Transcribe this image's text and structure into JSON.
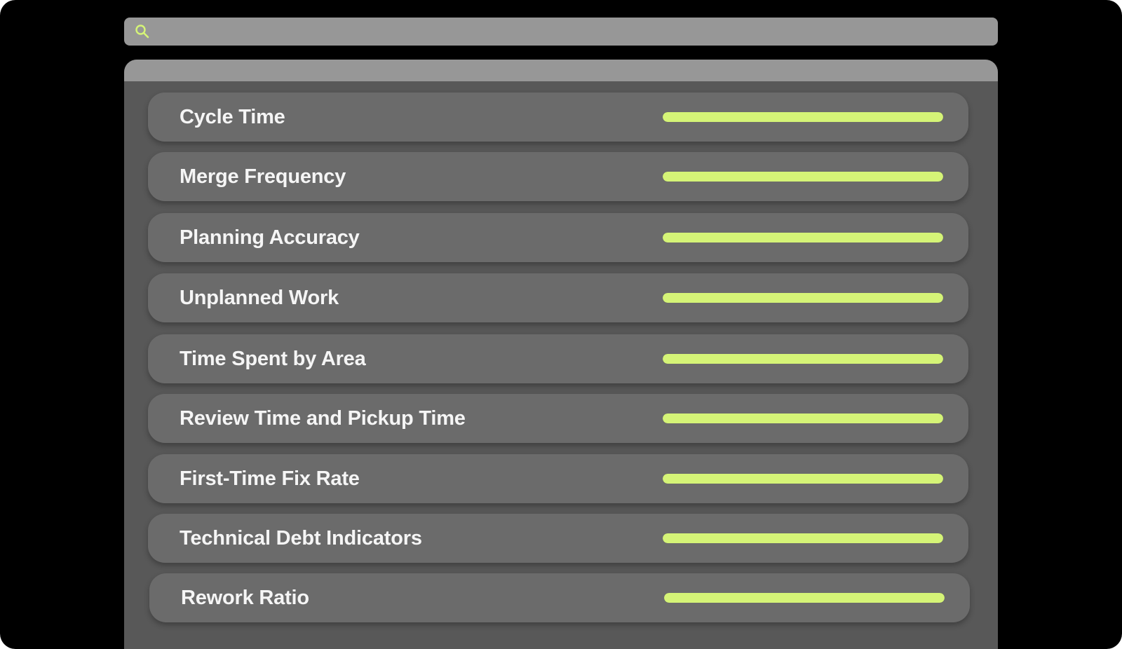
{
  "search": {
    "icon": "search-icon",
    "placeholder": ""
  },
  "colors": {
    "accent": "#d5f477",
    "row_background": "#6b6b6b",
    "panel_background": "#585858",
    "header_background": "#979797",
    "page_background": "#000000"
  },
  "metrics": [
    {
      "label": "Cycle Time",
      "progress": 1.0
    },
    {
      "label": "Merge Frequency",
      "progress": 1.0
    },
    {
      "label": "Planning Accuracy",
      "progress": 1.0
    },
    {
      "label": "Unplanned Work",
      "progress": 1.0
    },
    {
      "label": "Time Spent by Area",
      "progress": 1.0
    },
    {
      "label": "Review Time and Pickup Time",
      "progress": 1.0
    },
    {
      "label": "First-Time Fix Rate",
      "progress": 1.0
    },
    {
      "label": "Technical Debt Indicators",
      "progress": 1.0
    },
    {
      "label": "Rework Ratio",
      "progress": 1.0
    }
  ]
}
